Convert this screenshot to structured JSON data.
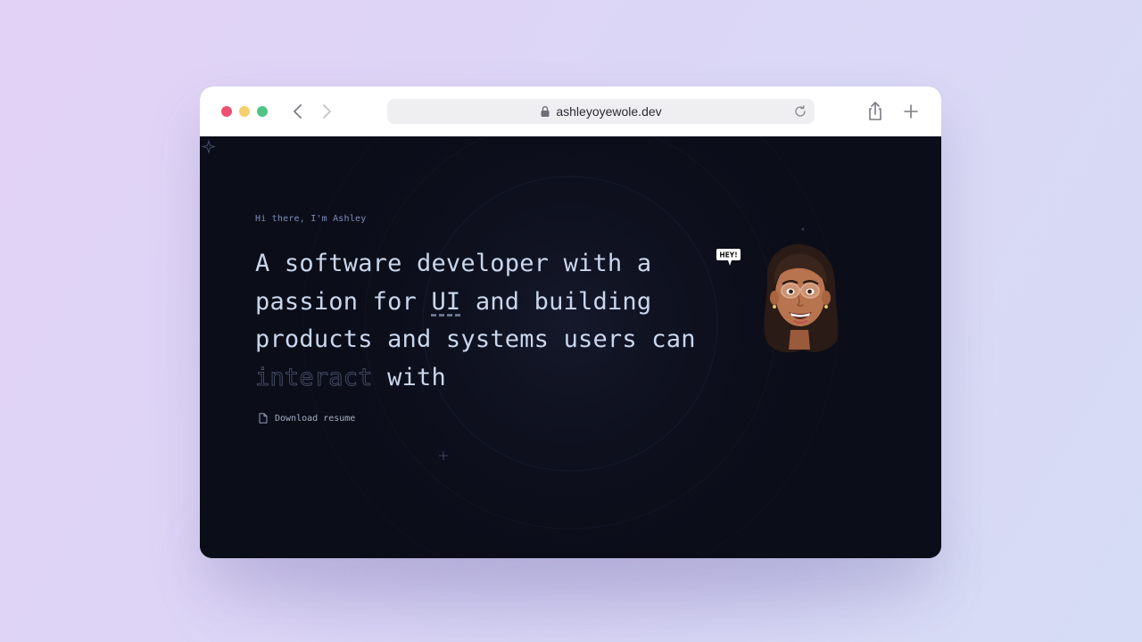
{
  "browser": {
    "url": "ashleyoyewole.dev",
    "controls": {
      "close": "close",
      "minimize": "minimize",
      "zoom": "zoom"
    },
    "icons": {
      "back": "chevron-left-icon",
      "forward": "chevron-right-icon",
      "lock": "lock-icon",
      "reload": "reload-icon",
      "share": "share-icon",
      "new_tab": "plus-icon"
    }
  },
  "hero": {
    "greeting": "Hi there, I'm Ashley",
    "headline": {
      "part1": "A software developer with a passion for ",
      "ui": "UI",
      "part2": " and building products and systems users can ",
      "interact": "interact",
      "part3": " with"
    },
    "resume_label": "Download resume",
    "speech_bubble": "HEY!"
  },
  "colors": {
    "page_bg_start": "#e2d2f6",
    "page_bg_end": "#d6dcf5",
    "site_bg": "#0b0d19",
    "headline_text": "#c9d6ec",
    "greeting_text": "#7d8fb8",
    "traffic_red": "#ec4f72",
    "traffic_yellow": "#f5cf6b",
    "traffic_green": "#4fc585"
  }
}
